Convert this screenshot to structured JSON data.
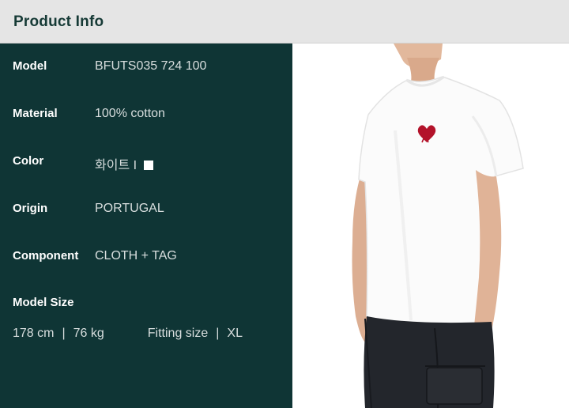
{
  "header": {
    "title": "Product Info"
  },
  "info": [
    {
      "label": "Model",
      "value": "BFUTS035 724 100"
    },
    {
      "label": "Material",
      "value": "100% cotton"
    },
    {
      "label": "Color",
      "value": "화이트 I"
    },
    {
      "label": "Origin",
      "value": "PORTUGAL"
    },
    {
      "label": "Component",
      "value": "CLOTH + TAG"
    }
  ],
  "model_size": {
    "label": "Model Size",
    "height": "178 cm",
    "sep1": "|",
    "weight": "76 kg",
    "fitting_label": "Fitting size",
    "sep2": "|",
    "fitting_value": "XL"
  },
  "colors": {
    "header_bg": "#e5e5e5",
    "panel_bg": "#0f3535",
    "title_text": "#163a36",
    "swatch": "#ffffff",
    "logo_red": "#b3122a"
  },
  "photo": {
    "subject": "model wearing white t-shirt with red heart logo and dark cargo pants"
  }
}
